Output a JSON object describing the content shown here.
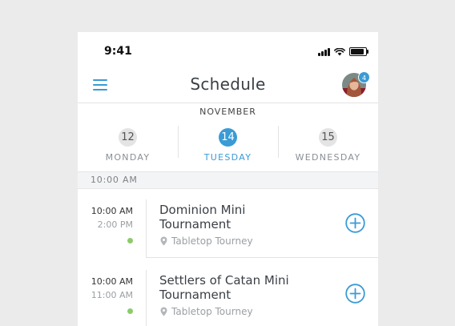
{
  "status_bar": {
    "time": "9:41"
  },
  "nav": {
    "title": "Schedule",
    "notification_count": "4"
  },
  "calendar": {
    "month": "NOVEMBER",
    "days": [
      {
        "num": "12",
        "name": "MONDAY",
        "active": false
      },
      {
        "num": "14",
        "name": "TUESDAY",
        "active": true
      },
      {
        "num": "15",
        "name": "WEDNESDAY",
        "active": false
      }
    ]
  },
  "section": {
    "label": "10:00 AM"
  },
  "events": [
    {
      "start": "10:00 AM",
      "end": "2:00 PM",
      "title": "Dominion Mini Tournament",
      "location": "Tabletop Tourney"
    },
    {
      "start": "10:00 AM",
      "end": "11:00 AM",
      "title": "Settlers of Catan Mini Tournament",
      "location": "Tabletop Tourney"
    }
  ],
  "colors": {
    "accent": "#3a9bd5",
    "status_dot": "#8ccb6b"
  },
  "icons": {
    "menu": "hamburger-icon",
    "avatar": "avatar",
    "location": "map-pin-icon",
    "add": "plus-circle-icon"
  }
}
